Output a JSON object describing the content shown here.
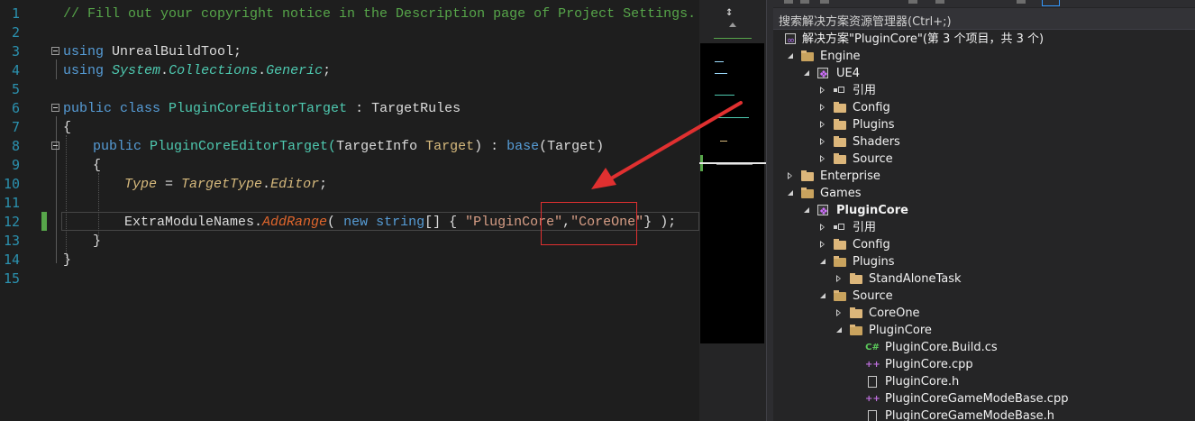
{
  "editor": {
    "lines": [
      {
        "n": "1"
      },
      {
        "n": "2"
      },
      {
        "n": "3"
      },
      {
        "n": "4"
      },
      {
        "n": "5"
      },
      {
        "n": "6"
      },
      {
        "n": "7"
      },
      {
        "n": "8"
      },
      {
        "n": "9"
      },
      {
        "n": "10"
      },
      {
        "n": "11"
      },
      {
        "n": "12"
      },
      {
        "n": "13"
      },
      {
        "n": "14"
      },
      {
        "n": "15"
      }
    ],
    "code": {
      "l1": "// Fill out your copyright notice in the Description page of Project Settings.",
      "l3_kw": "using",
      "l3_rest": " UnrealBuildTool;",
      "l4_kw": "using",
      "l4_a": "System",
      "l4_b": "Collections",
      "l4_c": "Generic",
      "l6_kw": "public class",
      "l6_name": " PluginCoreEditorTarget",
      "l6_sep": " : ",
      "l6_base": "TargetRules",
      "l7": "{",
      "l8_kw": "public",
      "l8_name": " PluginCoreEditorTarget(",
      "l8_type": "TargetInfo",
      "l8_param": " Target",
      "l8_mid": ") : ",
      "l8_base": "base",
      "l8_arg": "(Target)",
      "l9": "{",
      "l10_a": "Type",
      "l10_eq": " = ",
      "l10_b": "TargetType",
      "l10_c": "Editor",
      "l12_a": "ExtraModuleNames.",
      "l12_m": "AddRange",
      "l12_p1": "( ",
      "l12_new": "new",
      "l12_sp": " ",
      "l12_string": "string",
      "l12_arr": "[] { ",
      "l12_s1": "\"PluginCore\"",
      "l12_comma": ",",
      "l12_s2": "\"CoreOne\"",
      "l12_end": "} );",
      "l13": "}",
      "l14": "}"
    }
  },
  "minimap": {
    "split_glyph": "↕"
  },
  "solution_explorer": {
    "search_placeholder": "搜索解决方案资源管理器(Ctrl+;)",
    "tree": [
      {
        "label": "解决方案\"PluginCore\"(第 3 个项目，共 3 个)",
        "icon": "solution-icon"
      },
      {
        "label": "Engine",
        "icon": "folder-icon"
      },
      {
        "label": "UE4",
        "icon": "project-icon"
      },
      {
        "label": "引用",
        "icon": "references-icon"
      },
      {
        "label": "Config",
        "icon": "folder-icon"
      },
      {
        "label": "Plugins",
        "icon": "folder-icon"
      },
      {
        "label": "Shaders",
        "icon": "folder-icon"
      },
      {
        "label": "Source",
        "icon": "folder-icon"
      },
      {
        "label": "Enterprise",
        "icon": "folder-icon"
      },
      {
        "label": "Games",
        "icon": "folder-icon"
      },
      {
        "label": "PluginCore",
        "icon": "project-icon"
      },
      {
        "label": "引用",
        "icon": "references-icon"
      },
      {
        "label": "Config",
        "icon": "folder-icon"
      },
      {
        "label": "Plugins",
        "icon": "folder-icon"
      },
      {
        "label": "StandAloneTask",
        "icon": "folder-icon"
      },
      {
        "label": "Source",
        "icon": "folder-icon"
      },
      {
        "label": "CoreOne",
        "icon": "folder-icon"
      },
      {
        "label": "PluginCore",
        "icon": "folder-icon"
      },
      {
        "label": "PluginCore.Build.cs",
        "icon": "csharp-file-icon"
      },
      {
        "label": "PluginCore.cpp",
        "icon": "cpp-file-icon"
      },
      {
        "label": "PluginCore.h",
        "icon": "header-file-icon"
      },
      {
        "label": "PluginCoreGameModeBase.cpp",
        "icon": "cpp-file-icon"
      },
      {
        "label": "PluginCoreGameModeBase.h",
        "icon": "header-file-icon"
      }
    ]
  },
  "colors": {
    "annotation_red": "#e03030",
    "editor_bg": "#1e1e1e",
    "line_number": "#2b91af"
  }
}
